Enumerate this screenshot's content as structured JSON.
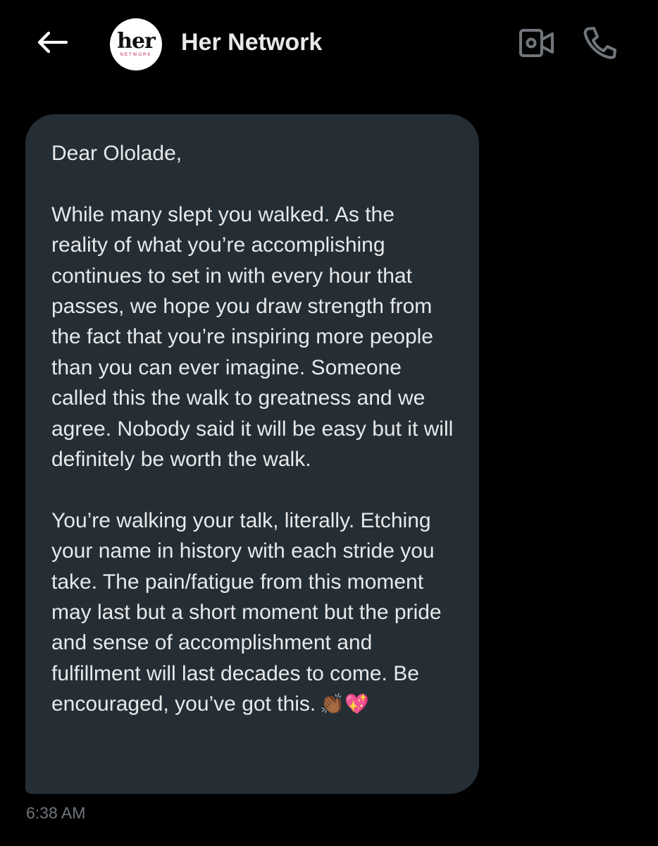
{
  "header": {
    "back_icon": "arrow-left-icon",
    "avatar": {
      "logo_main": "her",
      "logo_sub": "NETWORK"
    },
    "contact_name": "Her Network",
    "video_icon": "video-camera-icon",
    "phone_icon": "phone-icon"
  },
  "message": {
    "greeting": "Dear Ololade,",
    "paragraph_1": "While many slept you walked. As the reality of what you’re accomplishing continues to set in with every hour that passes, we hope you draw strength from the fact that you’re inspiring more people than you can ever imagine. Someone called this the walk to greatness and we agree. Nobody said it will be easy but it will definitely be worth the walk.",
    "paragraph_2": "You’re walking your talk, literally. Etching your name in history with each stride you take. The pain/fatigue from this moment may last but a short moment but the pride and sense of accomplishment and fulfillment will last decades to come. Be encouraged, you’ve got this.",
    "emoji": "👏🏾💖",
    "timestamp": "6:38 AM"
  },
  "colors": {
    "background": "#000000",
    "bubble": "#252e35",
    "text": "#e7e9ea",
    "muted": "#71767b"
  }
}
